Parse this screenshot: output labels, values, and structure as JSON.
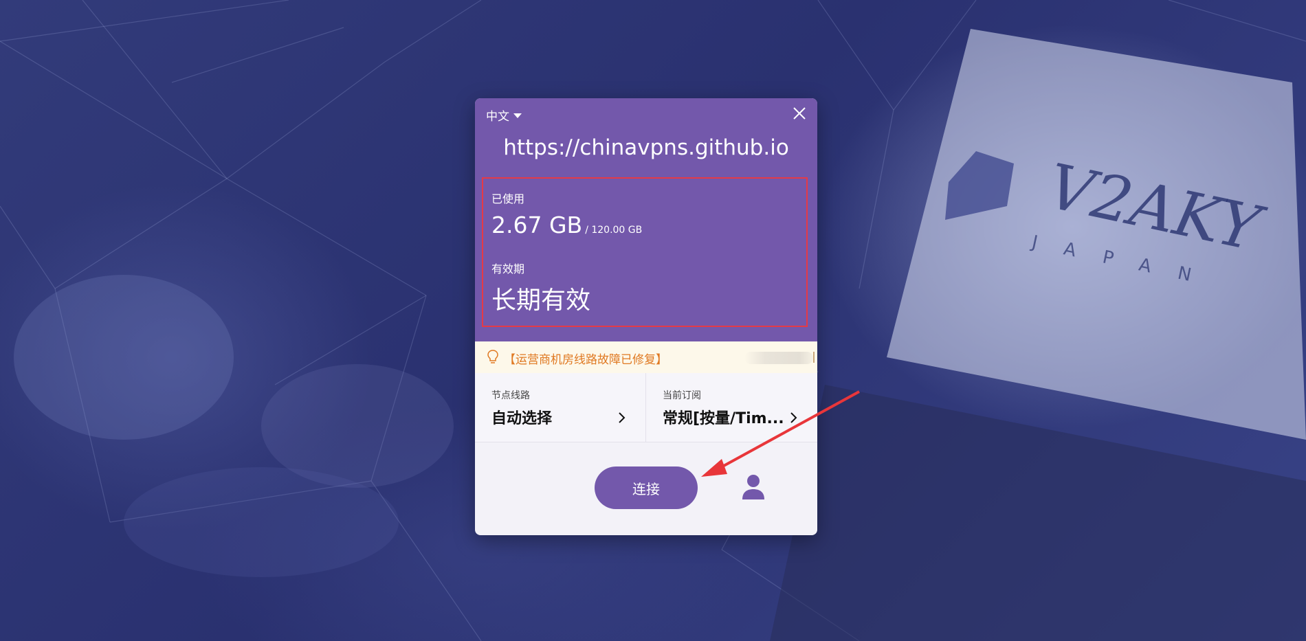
{
  "background": {
    "brand_text": "V2AKY",
    "brand_subtext": "J A P A N"
  },
  "dialog": {
    "language": "中文",
    "url": "https://chinavpns.github.io",
    "usage": {
      "label": "已使用",
      "used": "2.67 GB",
      "total": "/ 120.00 GB"
    },
    "validity": {
      "label": "有效期",
      "value": "长期有效"
    },
    "notice": "【运营商机房线路故障已修复】",
    "node": {
      "label": "节点线路",
      "value": "自动选择"
    },
    "subscription": {
      "label": "当前订阅",
      "value": "常规[按量/Tim..."
    },
    "connect_label": "连接"
  },
  "colors": {
    "accent": "#7358ab",
    "highlight_border": "#e53a46",
    "annotation_arrow": "#e8363a",
    "notice_text": "#e07922"
  }
}
